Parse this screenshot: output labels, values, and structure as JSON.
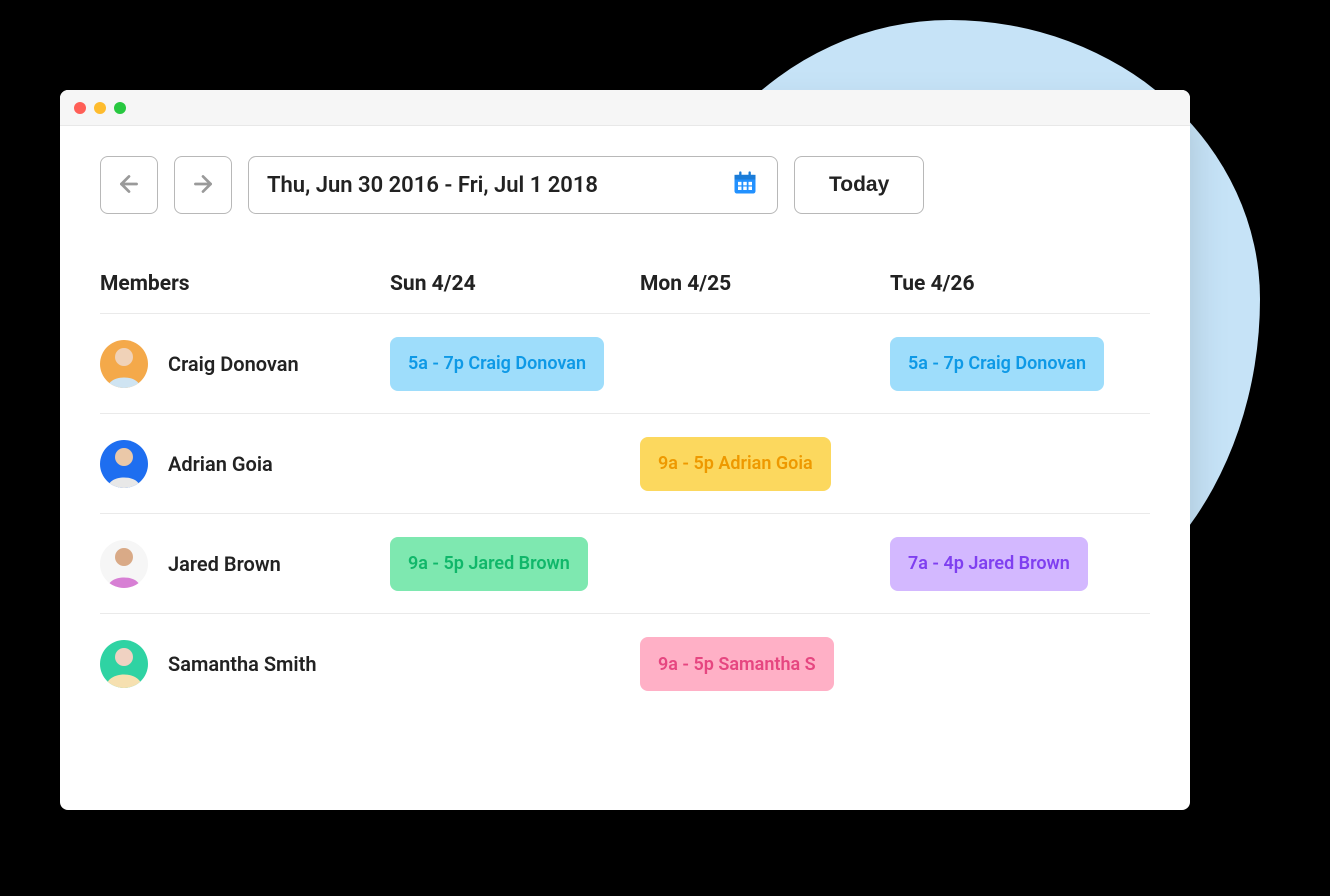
{
  "toolbar": {
    "date_range": "Thu, Jun 30 2016 - Fri, Jul 1 2018",
    "today_label": "Today"
  },
  "columns": {
    "members": "Members",
    "days": [
      "Sun 4/24",
      "Mon 4/25",
      "Tue 4/26"
    ]
  },
  "members": [
    {
      "name": "Craig Donovan",
      "avatar_bg": "#f4a94a"
    },
    {
      "name": "Adrian Goia",
      "avatar_bg": "#1e6ef0"
    },
    {
      "name": "Jared Brown",
      "avatar_bg": "#d77fd4"
    },
    {
      "name": "Samantha Smith",
      "avatar_bg": "#2fd3a3"
    }
  ],
  "shifts": [
    [
      {
        "text": "5a - 7p Craig Donovan",
        "color": "blue"
      },
      null,
      {
        "text": "5a - 7p Craig Donovan",
        "color": "blue"
      }
    ],
    [
      null,
      {
        "text": "9a - 5p Adrian Goia",
        "color": "yellow"
      },
      null
    ],
    [
      {
        "text": "9a - 5p Jared Brown",
        "color": "green"
      },
      null,
      {
        "text": "7a - 4p Jared Brown",
        "color": "purple"
      }
    ],
    [
      null,
      {
        "text": "9a - 5p Samantha S",
        "color": "pink"
      },
      null
    ]
  ]
}
